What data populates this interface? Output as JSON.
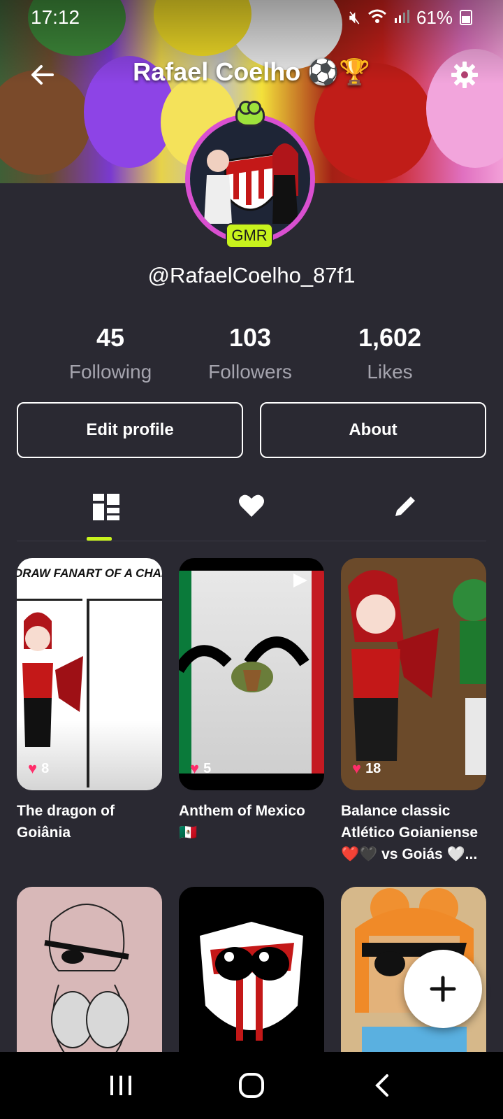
{
  "status_bar": {
    "time": "17:12",
    "battery": "61%"
  },
  "header": {
    "title": "Rafael Coelho ⚽️🏆"
  },
  "profile": {
    "handle": "@RafaelCoelho_87f1",
    "badge": "GMR"
  },
  "stats": [
    {
      "value": "45",
      "label": "Following"
    },
    {
      "value": "103",
      "label": "Followers"
    },
    {
      "value": "1,602",
      "label": "Likes"
    }
  ],
  "actions": {
    "edit_label": "Edit profile",
    "about_label": "About"
  },
  "tabs": [
    {
      "icon": "grid-icon",
      "active": true
    },
    {
      "icon": "heart-icon",
      "active": false
    },
    {
      "icon": "pencil-icon",
      "active": false
    }
  ],
  "posts": [
    {
      "title": "The dragon of Goiânia",
      "likes": "8",
      "thumb_text": "DRAW FANART OF A CHARACTER"
    },
    {
      "title": "Anthem of Mexico 🇲🇽",
      "likes": "5"
    },
    {
      "title": "Balance classic Atlético Goianiense ❤️🖤 vs Goiás 🤍...",
      "likes": "18"
    },
    {
      "title": ""
    },
    {
      "title": ""
    },
    {
      "title": ""
    }
  ],
  "colors": {
    "accent": "#c8f31d",
    "background": "#2a2932",
    "like": "#ff2d6a"
  }
}
